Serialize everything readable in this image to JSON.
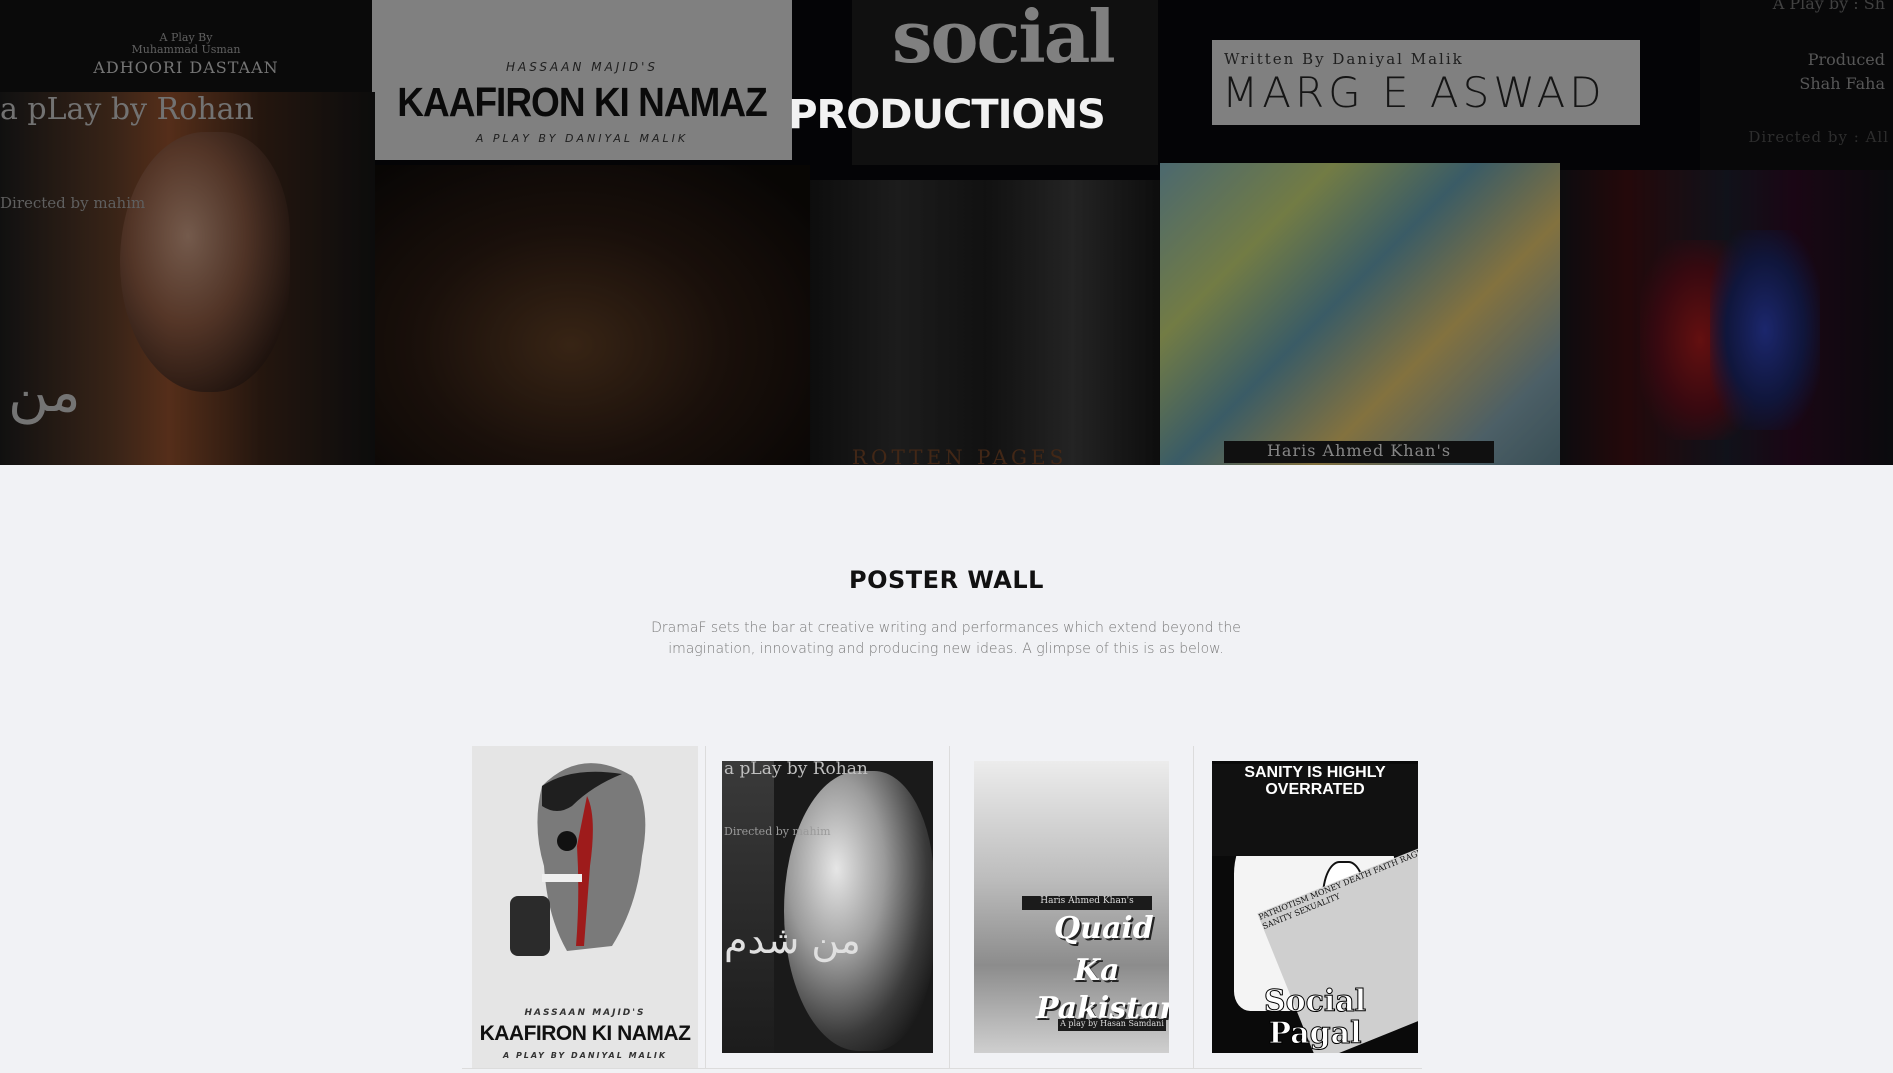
{
  "hero": {
    "title": "PRODUCTIONS",
    "tiles": {
      "adhoori": {
        "small_line1": "A Play By",
        "small_line2": "Muhammad Usman",
        "title": "ADHOORI DASTAAN"
      },
      "kaafiron": {
        "sub": "HASSAAN MAJID'S",
        "title": "KAAFIRON KI NAMAZ",
        "by": "A PLAY BY DANIYAL MALIK"
      },
      "social": {
        "title": "social"
      },
      "marg": {
        "written": "Written By Daniyal Malik",
        "title": "MARG E ASWAD"
      },
      "produced": {
        "top": "A Play by : Sh",
        "line1": "Produced",
        "line2": "Shah Faha",
        "directed": "Directed by : All"
      },
      "rohan": {
        "vertical": "a pLay by Rohan",
        "small": "Directed by mahim",
        "urdu": "من"
      },
      "rotten": {
        "caption": "ROTTEN PAGES"
      },
      "haris": {
        "caption": "Haris Ahmed Khan's"
      }
    }
  },
  "poster_wall": {
    "title": "POSTER WALL",
    "description": "DramaF sets the bar at creative writing and performances which extend beyond the imagination, innovating and producing new ideas. A glimpse of this is as below.",
    "posters": [
      {
        "sub": "HASSAAN MAJID'S",
        "title": "KAAFIRON KI NAMAZ",
        "by": "A PLAY BY DANIYAL MALIK"
      },
      {
        "vertical": "a pLay by Rohan",
        "small": "Directed by mahim",
        "urdu": "من شدم"
      },
      {
        "line1": "Haris Ahmed Khan's",
        "title1": "Quaid",
        "title2": "Ka",
        "title3": "Pakistan",
        "foot": "A play by Hasan Samdani"
      },
      {
        "top": "Sanity is highly overrated",
        "words": "PATRIOTISM MONEY DEATH FAITH RAGE VANITY FAMILY LUST ENVY EGO GREED LOVE FEAR SANITY SEXUALITY",
        "title1": "Social",
        "title2": "Pagal"
      }
    ]
  },
  "colors": {
    "page_bg": "#f1f2f5",
    "hero_bg": "#07070a",
    "title_text": "#111111",
    "desc_text": "#7b7b7b"
  }
}
